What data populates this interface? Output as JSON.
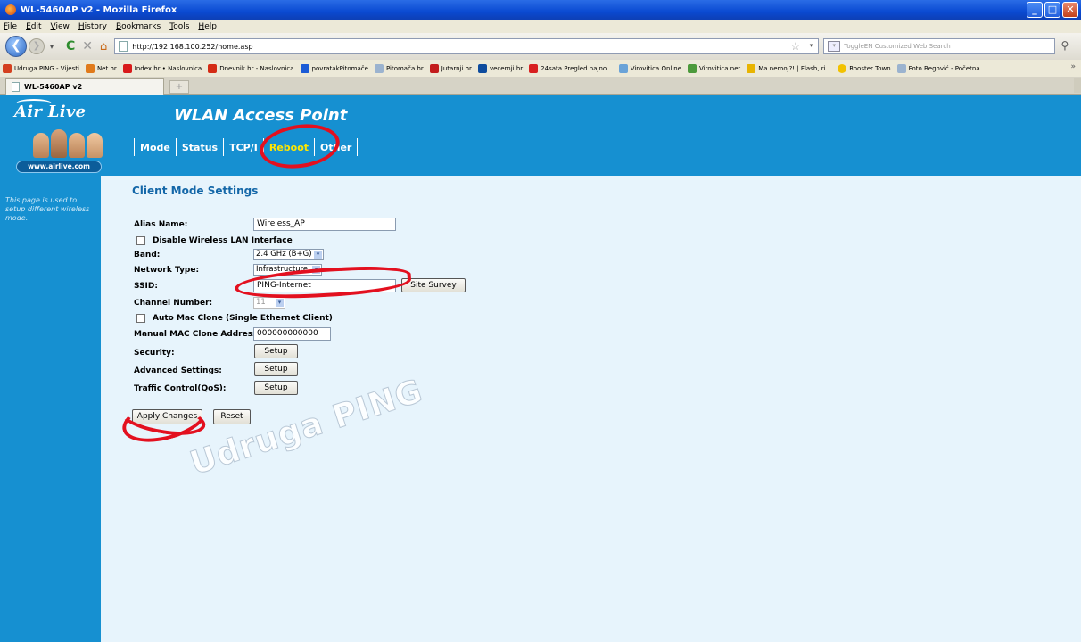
{
  "window": {
    "title": "WL-5460AP v2 - Mozilla Firefox"
  },
  "menu": [
    "File",
    "Edit",
    "View",
    "History",
    "Bookmarks",
    "Tools",
    "Help"
  ],
  "navbar": {
    "url": "http://192.168.100.252/home.asp",
    "search_placeholder": "ToggleEN Customized Web Search"
  },
  "bookmarks": [
    {
      "label": "Udruga PING - Vijesti",
      "color": "#d4401f"
    },
    {
      "label": "Net.hr",
      "color": "#e07a1a"
    },
    {
      "label": "Index.hr • Naslovnica",
      "color": "#d81a1a"
    },
    {
      "label": "Dnevnik.hr - Naslovnica",
      "color": "#d42b14"
    },
    {
      "label": "povratakPitomače",
      "color": "#1b5bd6"
    },
    {
      "label": "Pitomača.hr",
      "color": "#9bb3cf"
    },
    {
      "label": "Jutarnji.hr",
      "color": "#c31d1d"
    },
    {
      "label": "vecernji.hr",
      "color": "#0e4c9e"
    },
    {
      "label": "24sata Pregled najno...",
      "color": "#d82020"
    },
    {
      "label": "Virovitica Online",
      "color": "#6aa3d8"
    },
    {
      "label": "Virovitica.net",
      "color": "#4c9a3b"
    },
    {
      "label": "Ma nemoj?! | Flash, ri...",
      "color": "#e8b400"
    },
    {
      "label": "Rooster Town",
      "color": "#f2c200"
    },
    {
      "label": "Foto Begović - Početna",
      "color": "#9bb3cf"
    }
  ],
  "tab": {
    "label": "WL-5460AP v2"
  },
  "header": {
    "brand": "Air Live",
    "website": "www.airlive.com",
    "title": "WLAN Access Point",
    "tabs": [
      "Mode",
      "Status",
      "TCP/I",
      "Reboot",
      "Other"
    ]
  },
  "sidebar": {
    "text": "This page is used to setup different wireless mode."
  },
  "form": {
    "title": "Client Mode Settings",
    "alias_label": "Alias Name:",
    "alias_value": "Wireless_AP",
    "disable_wlan_label": "Disable Wireless LAN Interface",
    "band_label": "Band:",
    "band_value": "2.4 GHz (B+G)",
    "network_type_label": "Network Type:",
    "network_type_value": "Infrastructure",
    "ssid_label": "SSID:",
    "ssid_value": "PING-Internet",
    "site_survey": "Site Survey",
    "channel_label": "Channel Number:",
    "channel_value": "11",
    "auto_mac_label": "Auto Mac Clone (Single Ethernet Client)",
    "manual_mac_label": "Manual MAC Clone Address:",
    "manual_mac_value": "000000000000",
    "security_label": "Security:",
    "advanced_label": "Advanced Settings:",
    "traffic_label": "Traffic Control(QoS):",
    "setup_label": "Setup",
    "apply_label": "Apply Changes",
    "reset_label": "Reset"
  },
  "watermark": "Udruga PING"
}
